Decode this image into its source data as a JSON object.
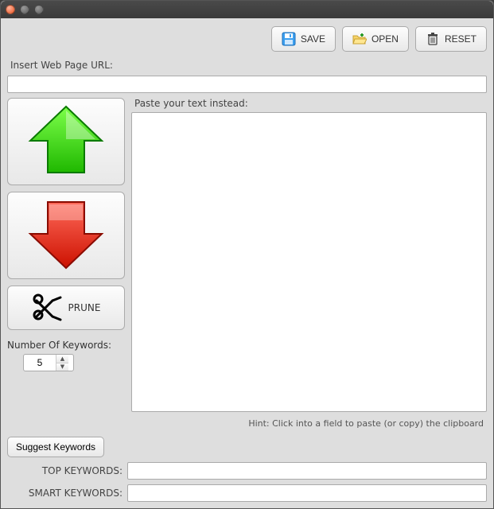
{
  "toolbar": {
    "save_label": "SAVE",
    "open_label": "OPEN",
    "reset_label": "RESET"
  },
  "url_section": {
    "label": "Insert Web Page URL:",
    "value": ""
  },
  "paste_section": {
    "label": "Paste your text instead:",
    "value": ""
  },
  "prune_label": "PRUNE",
  "keywords_count": {
    "label": "Number Of Keywords:",
    "value": "5"
  },
  "hint": "Hint: Click into a field to paste (or copy) the clipboard",
  "suggest_label": "Suggest Keywords",
  "top_keywords": {
    "label": "TOP KEYWORDS:",
    "value": ""
  },
  "smart_keywords": {
    "label": "SMART KEYWORDS:",
    "value": ""
  }
}
